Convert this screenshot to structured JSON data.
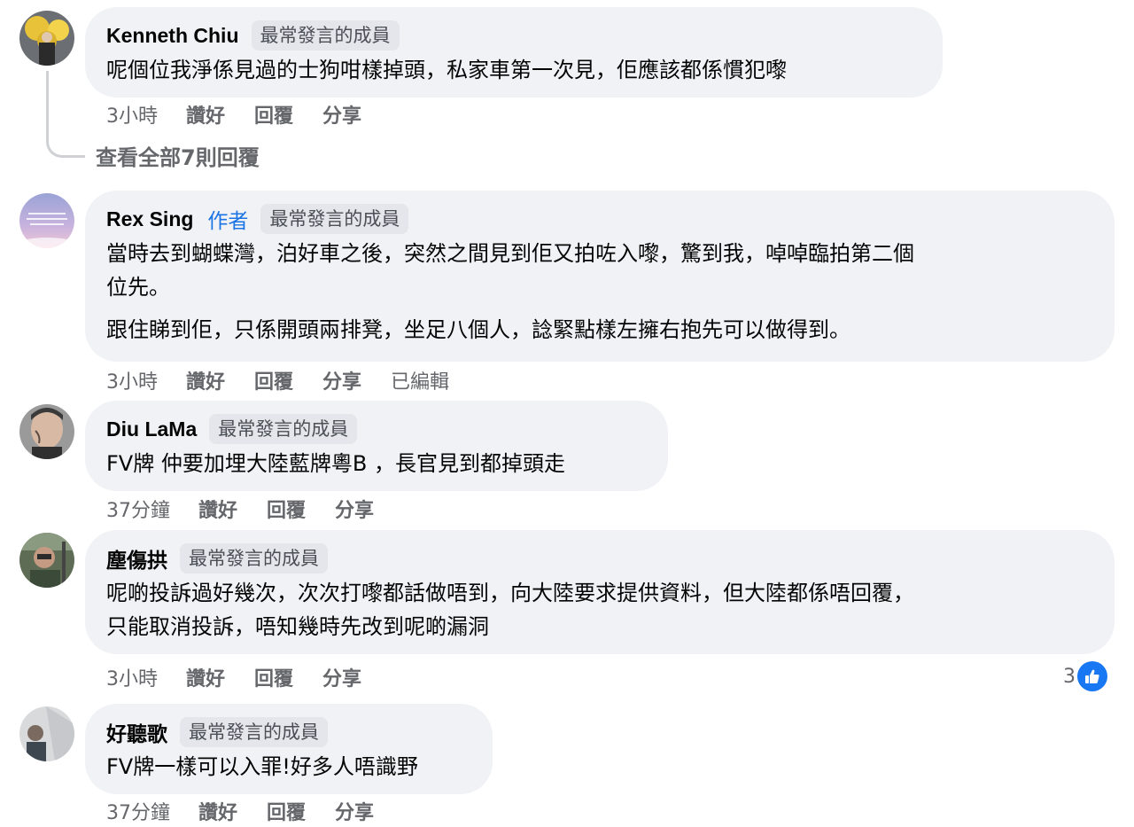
{
  "colors": {
    "bubble": "#f0f2f5",
    "badge": "#e4e6eb",
    "author": "#1b74e4",
    "like": "#1877f2",
    "meta": "#65676b"
  },
  "view_all_replies": "查看全部7則回覆",
  "comments": [
    {
      "name": "Kenneth Chiu",
      "badge": "最常發言的成員",
      "text": [
        "呢個位我淨係見過的士狗咁樣掉頭，私家車第一次見，佢應該都係慣犯嚟"
      ],
      "time": "3小時",
      "like": "讚好",
      "reply": "回覆",
      "share": "分享"
    },
    {
      "name": "Rex Sing",
      "author_tag": "作者",
      "badge": "最常發言的成員",
      "text": [
        "當時去到蝴蝶灣，泊好車之後，突然之間見到佢又拍咗入嚟，驚到我，啅啅臨拍第二個",
        "位先。",
        "跟住睇到佢，只係開頭兩排凳，坐足八個人，諗緊點樣左擁右抱先可以做得到。"
      ],
      "time": "3小時",
      "like": "讚好",
      "reply": "回覆",
      "share": "分享",
      "edited": "已編輯"
    },
    {
      "name": "Diu LaMa",
      "badge": "最常發言的成員",
      "text": [
        "FV牌 仲要加埋大陸藍牌粵B ，長官見到都掉頭走"
      ],
      "time": "37分鐘",
      "like": "讚好",
      "reply": "回覆",
      "share": "分享"
    },
    {
      "name": "塵傷拱",
      "badge": "最常發言的成員",
      "text": [
        "呢啲投訴過好幾次，次次打嚟都話做唔到，向大陸要求提供資料，但大陸都係唔回覆，",
        "只能取消投訴，唔知幾時先改到呢啲漏洞"
      ],
      "time": "3小時",
      "like": "讚好",
      "reply": "回覆",
      "share": "分享",
      "reactions": "3"
    },
    {
      "name": "好聽歌",
      "badge": "最常發言的成員",
      "text": [
        "FV牌一樣可以入罪!好多人唔識野"
      ],
      "time": "37分鐘",
      "like": "讚好",
      "reply": "回覆",
      "share": "分享"
    }
  ]
}
